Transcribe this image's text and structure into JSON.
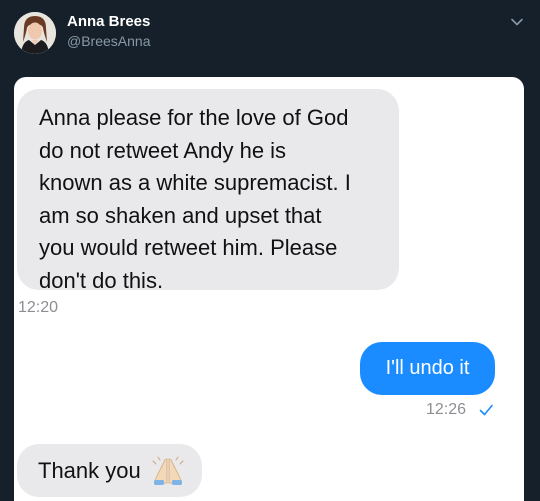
{
  "tweet": {
    "display_name": "Anna Brees",
    "handle": "@BreesAnna",
    "menu_icon": "chevron-down-icon"
  },
  "conversation": {
    "messages": [
      {
        "direction": "incoming",
        "text": "Anna please for the love of God\ndo not retweet Andy he is\nknown as a white supremacist.  I\nam so shaken and upset that\nyou would retweet him. Please\ndon't do this.",
        "time": "12:20"
      },
      {
        "direction": "outgoing",
        "text": "I'll undo it",
        "time": "12:26",
        "status_icon": "checkmark-icon"
      },
      {
        "direction": "incoming",
        "text": "Thank you",
        "emoji": "folded-hands-icon"
      }
    ]
  },
  "colors": {
    "background": "#15202b",
    "incoming_bubble": "#e9e9eb",
    "outgoing_bubble": "#1a8cff",
    "secondary_text": "#8899a6"
  }
}
